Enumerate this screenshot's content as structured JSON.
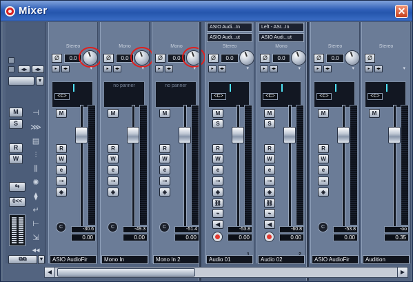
{
  "window": {
    "title": "Mixer",
    "close_label": "✕"
  },
  "left_panel": {
    "view_buttons": [
      "◂▸",
      "◂▸"
    ],
    "letter_buttons": [
      "M",
      "S",
      "R",
      "W"
    ],
    "clear_label": "0<<"
  },
  "strips": [
    {
      "bus": "Stereo",
      "gain": "0.0",
      "pan_label": "<C>",
      "panner": "pan",
      "peak": "-30.6",
      "volume": "0.00",
      "name": "ASIO AudioFir",
      "buttons": [
        "M",
        "R",
        "W",
        "e"
      ],
      "routing": [],
      "number": ""
    },
    {
      "bus": "Mono",
      "gain": "0.0",
      "pan_label": "",
      "panner": "no panner",
      "peak": "-49.3",
      "volume": "0.00",
      "name": "Mono In",
      "buttons": [
        "M",
        "R",
        "W",
        "e"
      ],
      "routing": [],
      "number": ""
    },
    {
      "bus": "Mono",
      "gain": "0.0",
      "pan_label": "",
      "panner": "no panner",
      "peak": "-51.4",
      "volume": "0.00",
      "name": "Mono In 2",
      "buttons": [
        "M",
        "R",
        "W",
        "e"
      ],
      "routing": [],
      "number": ""
    },
    {
      "bus": "Stereo",
      "gain": "0.0",
      "pan_label": "<C>",
      "panner": "pan",
      "peak": "-53.8",
      "volume": "0.00",
      "name": "Audio 01",
      "buttons": [
        "M",
        "S",
        "R",
        "W",
        "e"
      ],
      "routing": [
        "ASIO Audi...In",
        "ASIO Audi...ut"
      ],
      "number": "1"
    },
    {
      "bus": "Mono",
      "gain": "0.0",
      "pan_label": "<C>",
      "panner": "pan",
      "peak": "-60.8",
      "volume": "0.00",
      "name": "Audio 02",
      "buttons": [
        "M",
        "S",
        "R",
        "W",
        "e"
      ],
      "routing": [
        "Left - ASI...In",
        "ASIO Audi...ut"
      ],
      "number": "2"
    },
    {
      "bus": "Stereo",
      "gain": "0.0",
      "pan_label": "<C>",
      "panner": "pan",
      "peak": "-53.8",
      "volume": "0.00",
      "name": "ASIO AudioFir",
      "buttons": [
        "M",
        "R",
        "W",
        "e"
      ],
      "routing": [],
      "number": ""
    },
    {
      "bus": "Stereo",
      "gain": "",
      "pan_label": "<C>",
      "panner": "pan",
      "peak": "-oo",
      "volume": "0.35",
      "name": "Audition",
      "buttons": [
        "M"
      ],
      "routing": [],
      "number": ""
    }
  ],
  "scrollbar": {
    "left": "◀",
    "right": "▶"
  }
}
